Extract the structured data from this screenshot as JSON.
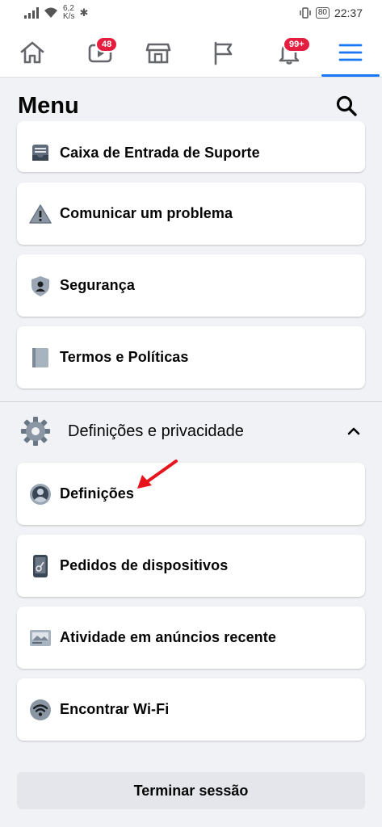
{
  "status_bar": {
    "speed_value": "6,2",
    "speed_unit": "K/s",
    "battery": "80",
    "time": "22:37"
  },
  "nav": {
    "watch_badge": "48",
    "notifications_badge": "99+",
    "accent_color": "#1877f2",
    "badge_color": "#e41e3f"
  },
  "header": {
    "title": "Menu"
  },
  "menu_items": [
    {
      "label": "Caixa de Entrada de Suporte",
      "icon": "inbox-icon"
    },
    {
      "label": "Comunicar um problema",
      "icon": "warning-icon"
    },
    {
      "label": "Segurança",
      "icon": "shield-icon"
    },
    {
      "label": "Termos e Políticas",
      "icon": "book-icon"
    }
  ],
  "settings_section": {
    "title": "Definições e privacidade",
    "icon": "gear-icon",
    "expanded": true,
    "items": [
      {
        "label": "Definições",
        "icon": "user-circle-icon"
      },
      {
        "label": "Pedidos de dispositivos",
        "icon": "phone-key-icon"
      },
      {
        "label": "Atividade em anúncios recente",
        "icon": "ads-activity-icon"
      },
      {
        "label": "Encontrar Wi-Fi",
        "icon": "wifi-icon"
      }
    ]
  },
  "logout": {
    "label": "Terminar sessão"
  }
}
